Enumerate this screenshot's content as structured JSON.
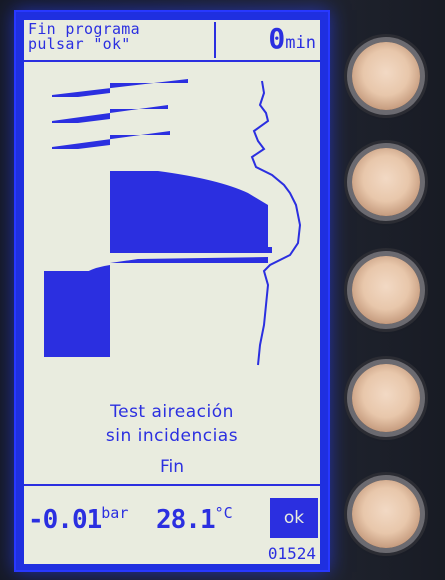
{
  "header": {
    "message_line1": "Fin programa",
    "message_line2": "pulsar \"ok\"",
    "time_value": "0",
    "time_unit": "min"
  },
  "result": {
    "line1": "Test aireación",
    "line2": "sin incidencias",
    "status": "Fin"
  },
  "readings": {
    "pressure_value": "-0.01",
    "pressure_unit": "bar",
    "temperature_value": "28.1",
    "temperature_unit": "°C"
  },
  "ok_label": "ok",
  "serial": "01524",
  "colors": {
    "screen_bg": "#e9ecdf",
    "foreground": "#2b2fe0",
    "frame": "#1f2fe0"
  },
  "hardware_buttons": [
    "button-1",
    "button-2",
    "button-3",
    "button-4",
    "button-5"
  ]
}
